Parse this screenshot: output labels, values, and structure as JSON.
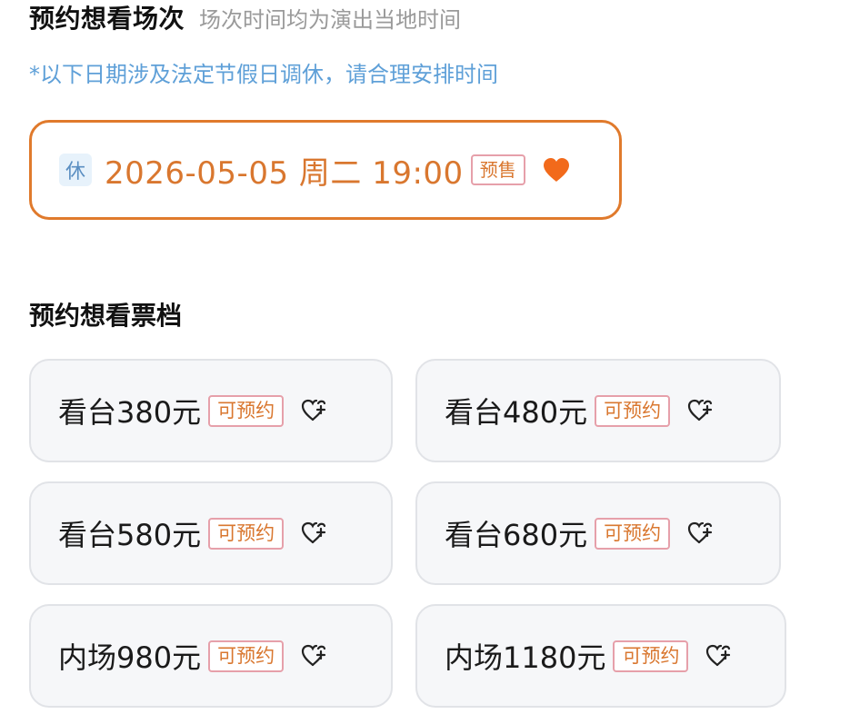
{
  "session_section": {
    "title": "预约想看场次",
    "subtitle": "场次时间均为演出当地时间",
    "notice": "*以下日期涉及法定节假日调休，请合理安排时间",
    "session": {
      "rest_tag": "休",
      "datetime": "2026-05-05 周二 19:00",
      "badge": "预售",
      "favorited": true,
      "heart_icon": "heart-filled-icon"
    }
  },
  "tier_section": {
    "title": "预约想看票档",
    "tiers": [
      {
        "label": "看台380元",
        "badge": "可预约",
        "icon": "heart-plus-icon"
      },
      {
        "label": "看台480元",
        "badge": "可预约",
        "icon": "heart-plus-icon"
      },
      {
        "label": "看台580元",
        "badge": "可预约",
        "icon": "heart-plus-icon"
      },
      {
        "label": "看台680元",
        "badge": "可预约",
        "icon": "heart-plus-icon"
      },
      {
        "label": "内场980元",
        "badge": "可预约",
        "icon": "heart-plus-icon"
      },
      {
        "label": "内场1180元",
        "badge": "可预约",
        "icon": "heart-plus-icon"
      }
    ]
  },
  "colors": {
    "accent_orange": "#d9772f",
    "card_border_orange": "#e07a2c",
    "heart_orange": "#f26a1b",
    "notice_blue": "#5fa0d8",
    "badge_border_pink": "#e6a0aa",
    "tier_card_bg": "#f6f7f9"
  }
}
